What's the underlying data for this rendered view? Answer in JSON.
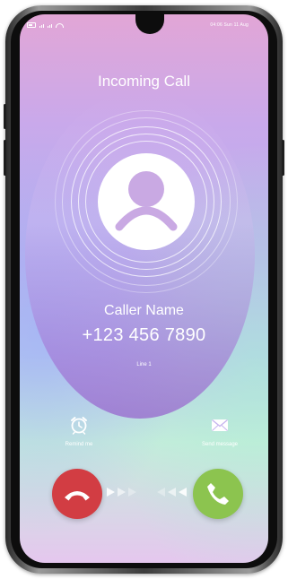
{
  "status_bar": {
    "time_date": "04:06   Sun 11 Aug"
  },
  "call": {
    "title": "Incoming Call",
    "caller_name": "Caller Name",
    "phone_number": "+123 456 7890",
    "line": "Line 1"
  },
  "actions": {
    "remind_label": "Remind me",
    "message_label": "Send message"
  },
  "colors": {
    "decline": "#d23d43",
    "accept": "#8cc44f",
    "avatar_icon": "#c9a9e3"
  },
  "icons": {
    "avatar": "person-icon",
    "remind": "alarm-clock-icon",
    "message": "envelope-icon",
    "decline": "hang-up-icon",
    "accept": "phone-icon"
  }
}
